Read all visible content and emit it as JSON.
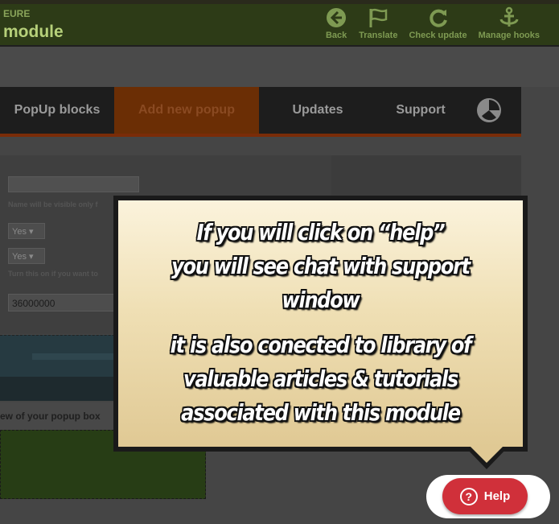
{
  "header": {
    "breadcrumb": "EURE",
    "title": "module",
    "tools": [
      {
        "label": "Back",
        "icon": "back-arrow-icon"
      },
      {
        "label": "Translate",
        "icon": "flag-icon"
      },
      {
        "label": "Check update",
        "icon": "refresh-icon"
      },
      {
        "label": "Manage hooks",
        "icon": "anchor-icon"
      }
    ]
  },
  "tabs": [
    {
      "label": "PopUp blocks"
    },
    {
      "label": "Add new popup"
    },
    {
      "label": "Updates"
    },
    {
      "label": "Support"
    }
  ],
  "form": {
    "name_hint": "Name will be visible only f",
    "select1_value": "Yes",
    "select2_value": "Yes",
    "toggle_hint": "Turn this on if you want to",
    "number_value": "36000000"
  },
  "preview_label": "ew of your popup box",
  "callout": {
    "lines": [
      "If you will click on “help”",
      "you will see chat with support",
      "window",
      "it is also conected to library of",
      "valuable articles & tutorials",
      "associated with this module"
    ]
  },
  "help_button": {
    "label": "Help",
    "icon": "question-mark-icon"
  },
  "colors": {
    "help_red": "#d0303a",
    "callout_bg": "#efdfb4",
    "tab_active": "#6b2e05"
  }
}
